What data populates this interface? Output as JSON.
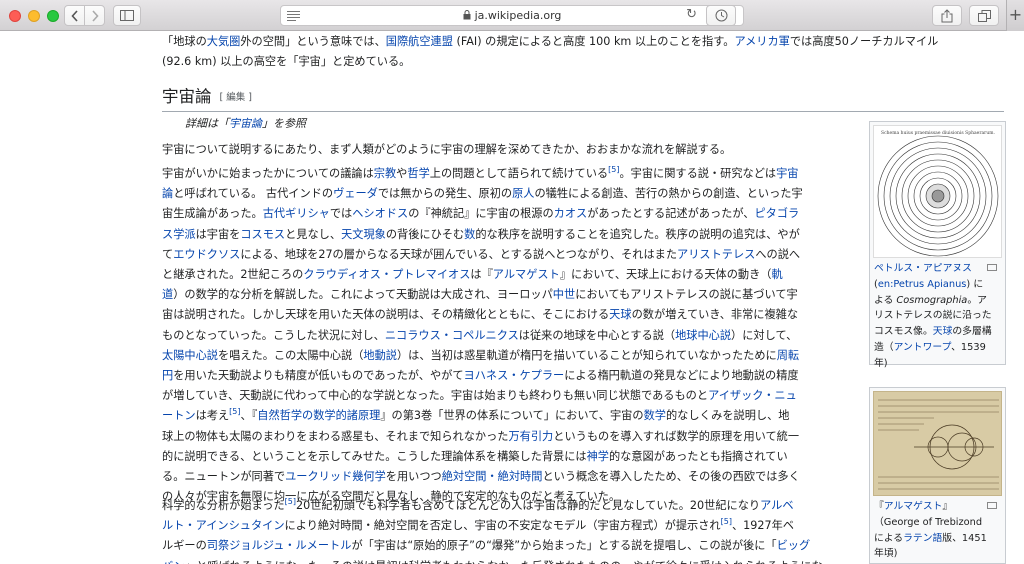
{
  "browser": {
    "url": "ja.wikipedia.org"
  },
  "intro": {
    "line1": [
      "「地球の",
      "大気圏",
      "外の空間」という意味では、",
      "国際航空連盟",
      " (FAI) の規定によると高度 100 km 以上のことを指す。",
      "アメリカ軍",
      "では高度50ノーチカルマイル"
    ],
    "line2": "(92.6 km) 以上の高空を「宇宙」と定めている。"
  },
  "section": {
    "title": "宇宙論",
    "edit": "[ 編集 ]",
    "hatnote": [
      "詳細は「",
      "宇宙論",
      "」を参照"
    ]
  },
  "para1": "宇宙について説明するにあたり、まず人類がどのように宇宙の理解を深めてきたか、おおまかな流れを解説する。",
  "para2": [
    [
      "宇宙がいかに始まったかについての議論は",
      "@宗教",
      "や",
      "@哲学",
      "上の問題として語られて続けている",
      "^[5]",
      "。宇宙に関する説・研究などは",
      "@宇宙"
    ],
    [
      "@論",
      "と呼ばれている。 古代インドの",
      "@ヴェーダ",
      "では無からの発生、原初の",
      "@原人",
      "の犠牲による創造、苦行の熱からの創造、といった宇"
    ],
    [
      "宙生成論があった。",
      "@古代ギリシャ",
      "では",
      "@ヘシオドス",
      "の『神統記』に宇宙の根源の",
      "@カオス",
      "があったとする記述があったが、",
      "@ピタゴラ"
    ],
    [
      "@ス学派",
      "は宇宙を",
      "@コスモス",
      "と見なし、",
      "@天文現象",
      "の背後にひそむ",
      "@数",
      "的な秩序を説明することを追究した。秩序の説明の追究は、やが"
    ],
    [
      "て",
      "@エウドクソス",
      "による、地球を27の層からなる天球が囲んでいる、とする説へとつながり、それはまた",
      "@アリストテレス",
      "への説へ"
    ],
    [
      "と継承された。2世紀ころの",
      "@クラウディオス・プトレマイオス",
      "は『",
      "@アルマゲスト",
      "』において、天球上における天体の動き（",
      "@軌"
    ],
    [
      "@道",
      "）の数学的な分析を解説した。これによって天動説は大成され、ヨーロッパ",
      "@中世",
      "においてもアリストテレスの説に基づいて宇"
    ],
    [
      "宙は説明された。しかし天球を用いた天体の説明は、その精緻化とともに、そこにおける",
      "@天球",
      "の数が増えていき、非常に複雑な"
    ],
    [
      "ものとなっていった。こうした状況に対し、",
      "@ニコラウス・コペルニクス",
      "は従来の地球を中心とする説（",
      "@地球中心説",
      "）に対して、"
    ],
    [
      "@太陽中心説",
      "を唱えた。この太陽中心説（",
      "@地動説",
      "）は、当初は惑星軌道が楕円を描いていることが知られていなかったために",
      "@周転"
    ],
    [
      "@円",
      "を用いた天動説よりも精度が低いものであったが、やがて",
      "@ヨハネス・ケプラー",
      "による楕円軌道の発見などにより地動説の精度"
    ],
    [
      "が増していき、天動説に代わって中心的な学説となった。宇宙は始まりも終わりも無い同じ状態であるものと",
      "@アイザック・ニュ"
    ],
    [
      "@ートン",
      "は考え",
      "^[5]",
      "、『",
      "@自然哲学の数学的諸原理",
      "』の第3巻「世界の体系について」において、宇宙の",
      "@数学",
      "的なしくみを説明し、地"
    ],
    [
      "球上の物体も太陽のまわりをまわる惑星も、それまで知られなかった",
      "@万有引力",
      "というものを導入すれば数学的原理を用いて統一"
    ],
    [
      "的に説明できる、ということを示してみせた。こうした理論体系を構築した背景には",
      "@神学",
      "的な意図があったとも指摘されてい"
    ],
    [
      "る。ニュートンが同著で",
      "@ユークリッド幾何学",
      "を用いつつ",
      "@絶対空間・絶対時間",
      "という概念を導入したため、その後の西欧では多く"
    ],
    [
      "の人々が宇宙を無限に均一に広がる空間だと見なし、静的で安定的なものだと考えていた。"
    ]
  ],
  "para3": [
    [
      "科学的な分析が始まった",
      "^[5]",
      "20世紀初頭でも科学者も含めてほとんどの人は宇宙は静的だと見なしていた。20世紀になり",
      "@アルベ"
    ],
    [
      "@ルト・アインシュタイン",
      "により絶対時間・絶対空間を否定し、宇宙の不安定なモデル（宇宙方程式）が提示され",
      "^[5]",
      "、1927年ベ"
    ],
    [
      "ルギーの",
      "@司祭",
      "@ジョルジュ・ルメートル",
      "が「宇宙は“原始的原子”の“爆発”から始まった」とする説を提唱し、この説が後に「",
      "@ビッグ"
    ],
    [
      "@バン",
      "」と呼ばれるようになった。その説は最初は科学者もわからなかった反発されたものの、やがて徐々に受け入れられるようにな"
    ]
  ],
  "figure1": {
    "title": "Schema huius praemissae diuisionis Sphaerarum.",
    "caption": [
      [
        "@ペトルス・アピアヌス"
      ],
      [
        "(",
        "@en:Petrus Apianus",
        ") に"
      ],
      [
        "よる ",
        "~Cosmographia",
        "。ア"
      ],
      [
        "リストテレスの説に沿った"
      ],
      [
        "コスモス像。",
        "@天球",
        "の多層構"
      ],
      [
        "造（",
        "@アントワープ",
        "、1539"
      ],
      [
        "年)"
      ]
    ]
  },
  "figure2": {
    "caption": [
      [
        "『",
        "@アルマゲスト",
        "』"
      ],
      [
        "（George of Trebizond"
      ],
      [
        "による",
        "@ラテン語",
        "版、1451"
      ],
      [
        "年頃)"
      ]
    ]
  }
}
